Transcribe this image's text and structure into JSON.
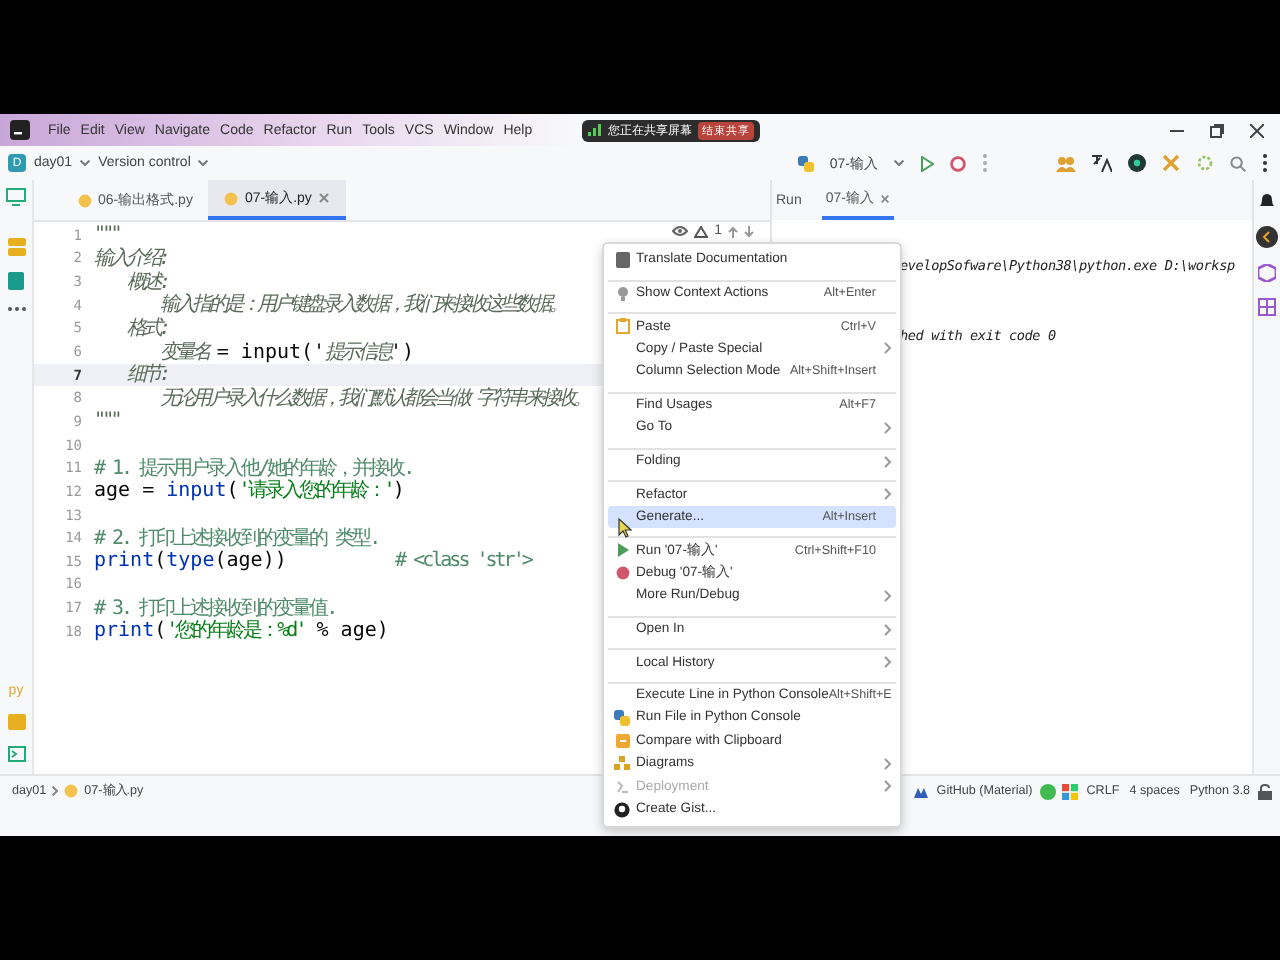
{
  "menu_bar": {
    "items": [
      "File",
      "Edit",
      "View",
      "Navigate",
      "Code",
      "Refactor",
      "Run",
      "Tools",
      "VCS",
      "Window",
      "Help"
    ]
  },
  "share_bar": {
    "message": "您正在共享屏幕",
    "stop_button": "结束共享"
  },
  "toolbar": {
    "project_badge": "D",
    "project": "day01",
    "vcs": "Version control",
    "run_config": "07-输入"
  },
  "editor_tabs": [
    {
      "label": "06-输出格式.py",
      "selected": false
    },
    {
      "label": "07-输入.py",
      "selected": true
    }
  ],
  "inspections": {
    "warnings": "1"
  },
  "code_lines": [
    {
      "number": "1",
      "current": false,
      "parts": [
        {
          "kind": "doc",
          "text": "\"\"\""
        }
      ]
    },
    {
      "number": "2",
      "current": false,
      "parts": [
        {
          "kind": "doc",
          "text": "输入介绍:"
        }
      ]
    },
    {
      "number": "3",
      "current": false,
      "parts": [
        {
          "kind": "doc",
          "text": "    概述:"
        }
      ]
    },
    {
      "number": "4",
      "current": false,
      "parts": [
        {
          "kind": "doc",
          "text": "        输入指的是：用户键盘录入数据，我们来接收这些数据。"
        }
      ]
    },
    {
      "number": "5",
      "current": false,
      "parts": [
        {
          "kind": "doc",
          "text": "    格式:"
        }
      ]
    },
    {
      "number": "6",
      "current": false,
      "parts": [
        {
          "kind": "doc",
          "text": "        变量名 "
        },
        {
          "kind": "code",
          "text": "= input('"
        },
        {
          "kind": "doc",
          "text": "提示信息"
        },
        {
          "kind": "code",
          "text": "')"
        }
      ]
    },
    {
      "number": "7",
      "current": true,
      "parts": [
        {
          "kind": "doc",
          "text": "    细节:"
        }
      ]
    },
    {
      "number": "8",
      "current": false,
      "parts": [
        {
          "kind": "doc",
          "text": "        无论用户录入什么数据，我们默认都会当做 字符串来接收。"
        }
      ]
    },
    {
      "number": "9",
      "current": false,
      "parts": [
        {
          "kind": "doc",
          "text": "\"\"\""
        }
      ]
    },
    {
      "number": "10",
      "current": false
    },
    {
      "number": "11",
      "current": false,
      "parts": [
        {
          "kind": "comment",
          "text": "# 1. 提示用户录入他/她的年龄，并接收."
        }
      ]
    },
    {
      "number": "12",
      "current": false,
      "parts": [
        {
          "kind": "code",
          "text": "age = "
        },
        {
          "kind": "builtin",
          "text": "input"
        },
        {
          "kind": "code",
          "text": "("
        },
        {
          "kind": "string",
          "text": "'请录入您的年龄：'"
        },
        {
          "kind": "code",
          "text": ")"
        }
      ]
    },
    {
      "number": "13",
      "current": false
    },
    {
      "number": "14",
      "current": false,
      "parts": [
        {
          "kind": "comment",
          "text": "# 2. 打印上述接收到的变量的 类型."
        }
      ]
    },
    {
      "number": "15",
      "current": false,
      "parts": [
        {
          "kind": "builtin",
          "text": "print"
        },
        {
          "kind": "code",
          "text": "("
        },
        {
          "kind": "builtin",
          "text": "type"
        },
        {
          "kind": "code",
          "text": "(age))         "
        },
        {
          "kind": "comment",
          "text": "# <class 'str'>"
        }
      ]
    },
    {
      "number": "16",
      "current": false
    },
    {
      "number": "17",
      "current": false,
      "parts": [
        {
          "kind": "comment",
          "text": "# 3. 打印上述接收到的变量值."
        }
      ]
    },
    {
      "number": "18",
      "current": false,
      "parts": [
        {
          "kind": "builtin",
          "text": "print"
        },
        {
          "kind": "code",
          "text": "("
        },
        {
          "kind": "string",
          "text": "'您的年龄是：%d'"
        },
        {
          "kind": "code",
          "text": " % age)"
        }
      ]
    }
  ],
  "run_panel": {
    "title": "Run",
    "tab": "07-输入",
    "output": [
      "evelopSofware\\Python38\\python.exe D:\\worksp",
      "hed with exit code 0"
    ]
  },
  "context_menu": {
    "items": [
      {
        "label": "Translate Documentation",
        "submenu": false,
        "selected": false,
        "disabled": false,
        "separator_before": false
      },
      {
        "label": "Show Context Actions",
        "shortcut": "Alt+Enter",
        "submenu": false,
        "selected": false,
        "disabled": false,
        "separator_before": true
      },
      {
        "label": "Paste",
        "shortcut": "Ctrl+V",
        "submenu": false,
        "selected": false,
        "disabled": false,
        "separator_before": true
      },
      {
        "label": "Copy / Paste Special",
        "submenu": true,
        "selected": false,
        "disabled": false,
        "separator_before": false
      },
      {
        "label": "Column Selection Mode",
        "shortcut": "Alt+Shift+Insert",
        "submenu": false,
        "selected": false,
        "disabled": false,
        "separator_before": false
      },
      {
        "label": "Find Usages",
        "shortcut": "Alt+F7",
        "submenu": false,
        "selected": false,
        "disabled": false,
        "separator_before": true
      },
      {
        "label": "Go To",
        "submenu": true,
        "selected": false,
        "disabled": false,
        "separator_before": false
      },
      {
        "label": "Folding",
        "submenu": true,
        "selected": false,
        "disabled": false,
        "separator_before": true
      },
      {
        "label": "Refactor",
        "submenu": true,
        "selected": false,
        "disabled": false,
        "separator_before": true
      },
      {
        "label": "Generate...",
        "shortcut": "Alt+Insert",
        "submenu": false,
        "selected": true,
        "disabled": false,
        "separator_before": false
      },
      {
        "label": "Run '07-输入'",
        "shortcut": "Ctrl+Shift+F10",
        "submenu": false,
        "selected": false,
        "disabled": false,
        "separator_before": true
      },
      {
        "label": "Debug '07-输入'",
        "submenu": false,
        "selected": false,
        "disabled": false,
        "separator_before": false
      },
      {
        "label": "More Run/Debug",
        "submenu": true,
        "selected": false,
        "disabled": false,
        "separator_before": false
      },
      {
        "label": "Open In",
        "submenu": true,
        "selected": false,
        "disabled": false,
        "separator_before": true
      },
      {
        "label": "Local History",
        "submenu": true,
        "selected": false,
        "disabled": false,
        "separator_before": true
      },
      {
        "label": "Execute Line in Python Console",
        "shortcut": "Alt+Shift+E",
        "submenu": false,
        "selected": false,
        "disabled": false,
        "separator_before": true
      },
      {
        "label": "Run File in Python Console",
        "submenu": false,
        "selected": false,
        "disabled": false,
        "separator_before": false
      },
      {
        "label": "Compare with Clipboard",
        "submenu": false,
        "selected": false,
        "disabled": false,
        "separator_before": false
      },
      {
        "label": "Diagrams",
        "submenu": true,
        "selected": false,
        "disabled": false,
        "separator_before": false
      },
      {
        "label": "Deployment",
        "submenu": true,
        "selected": false,
        "disabled": true,
        "separator_before": false
      },
      {
        "label": "Create Gist...",
        "submenu": false,
        "selected": false,
        "disabled": false,
        "separator_before": false
      }
    ]
  },
  "left_toolbar": {
    "label": "py"
  },
  "status_bar": {
    "breadcrumbs": [
      "day01",
      "07-输入.py"
    ],
    "items": [
      "GitHub (Material)",
      "CRLF",
      "4 spaces",
      "Python 3.8"
    ]
  }
}
